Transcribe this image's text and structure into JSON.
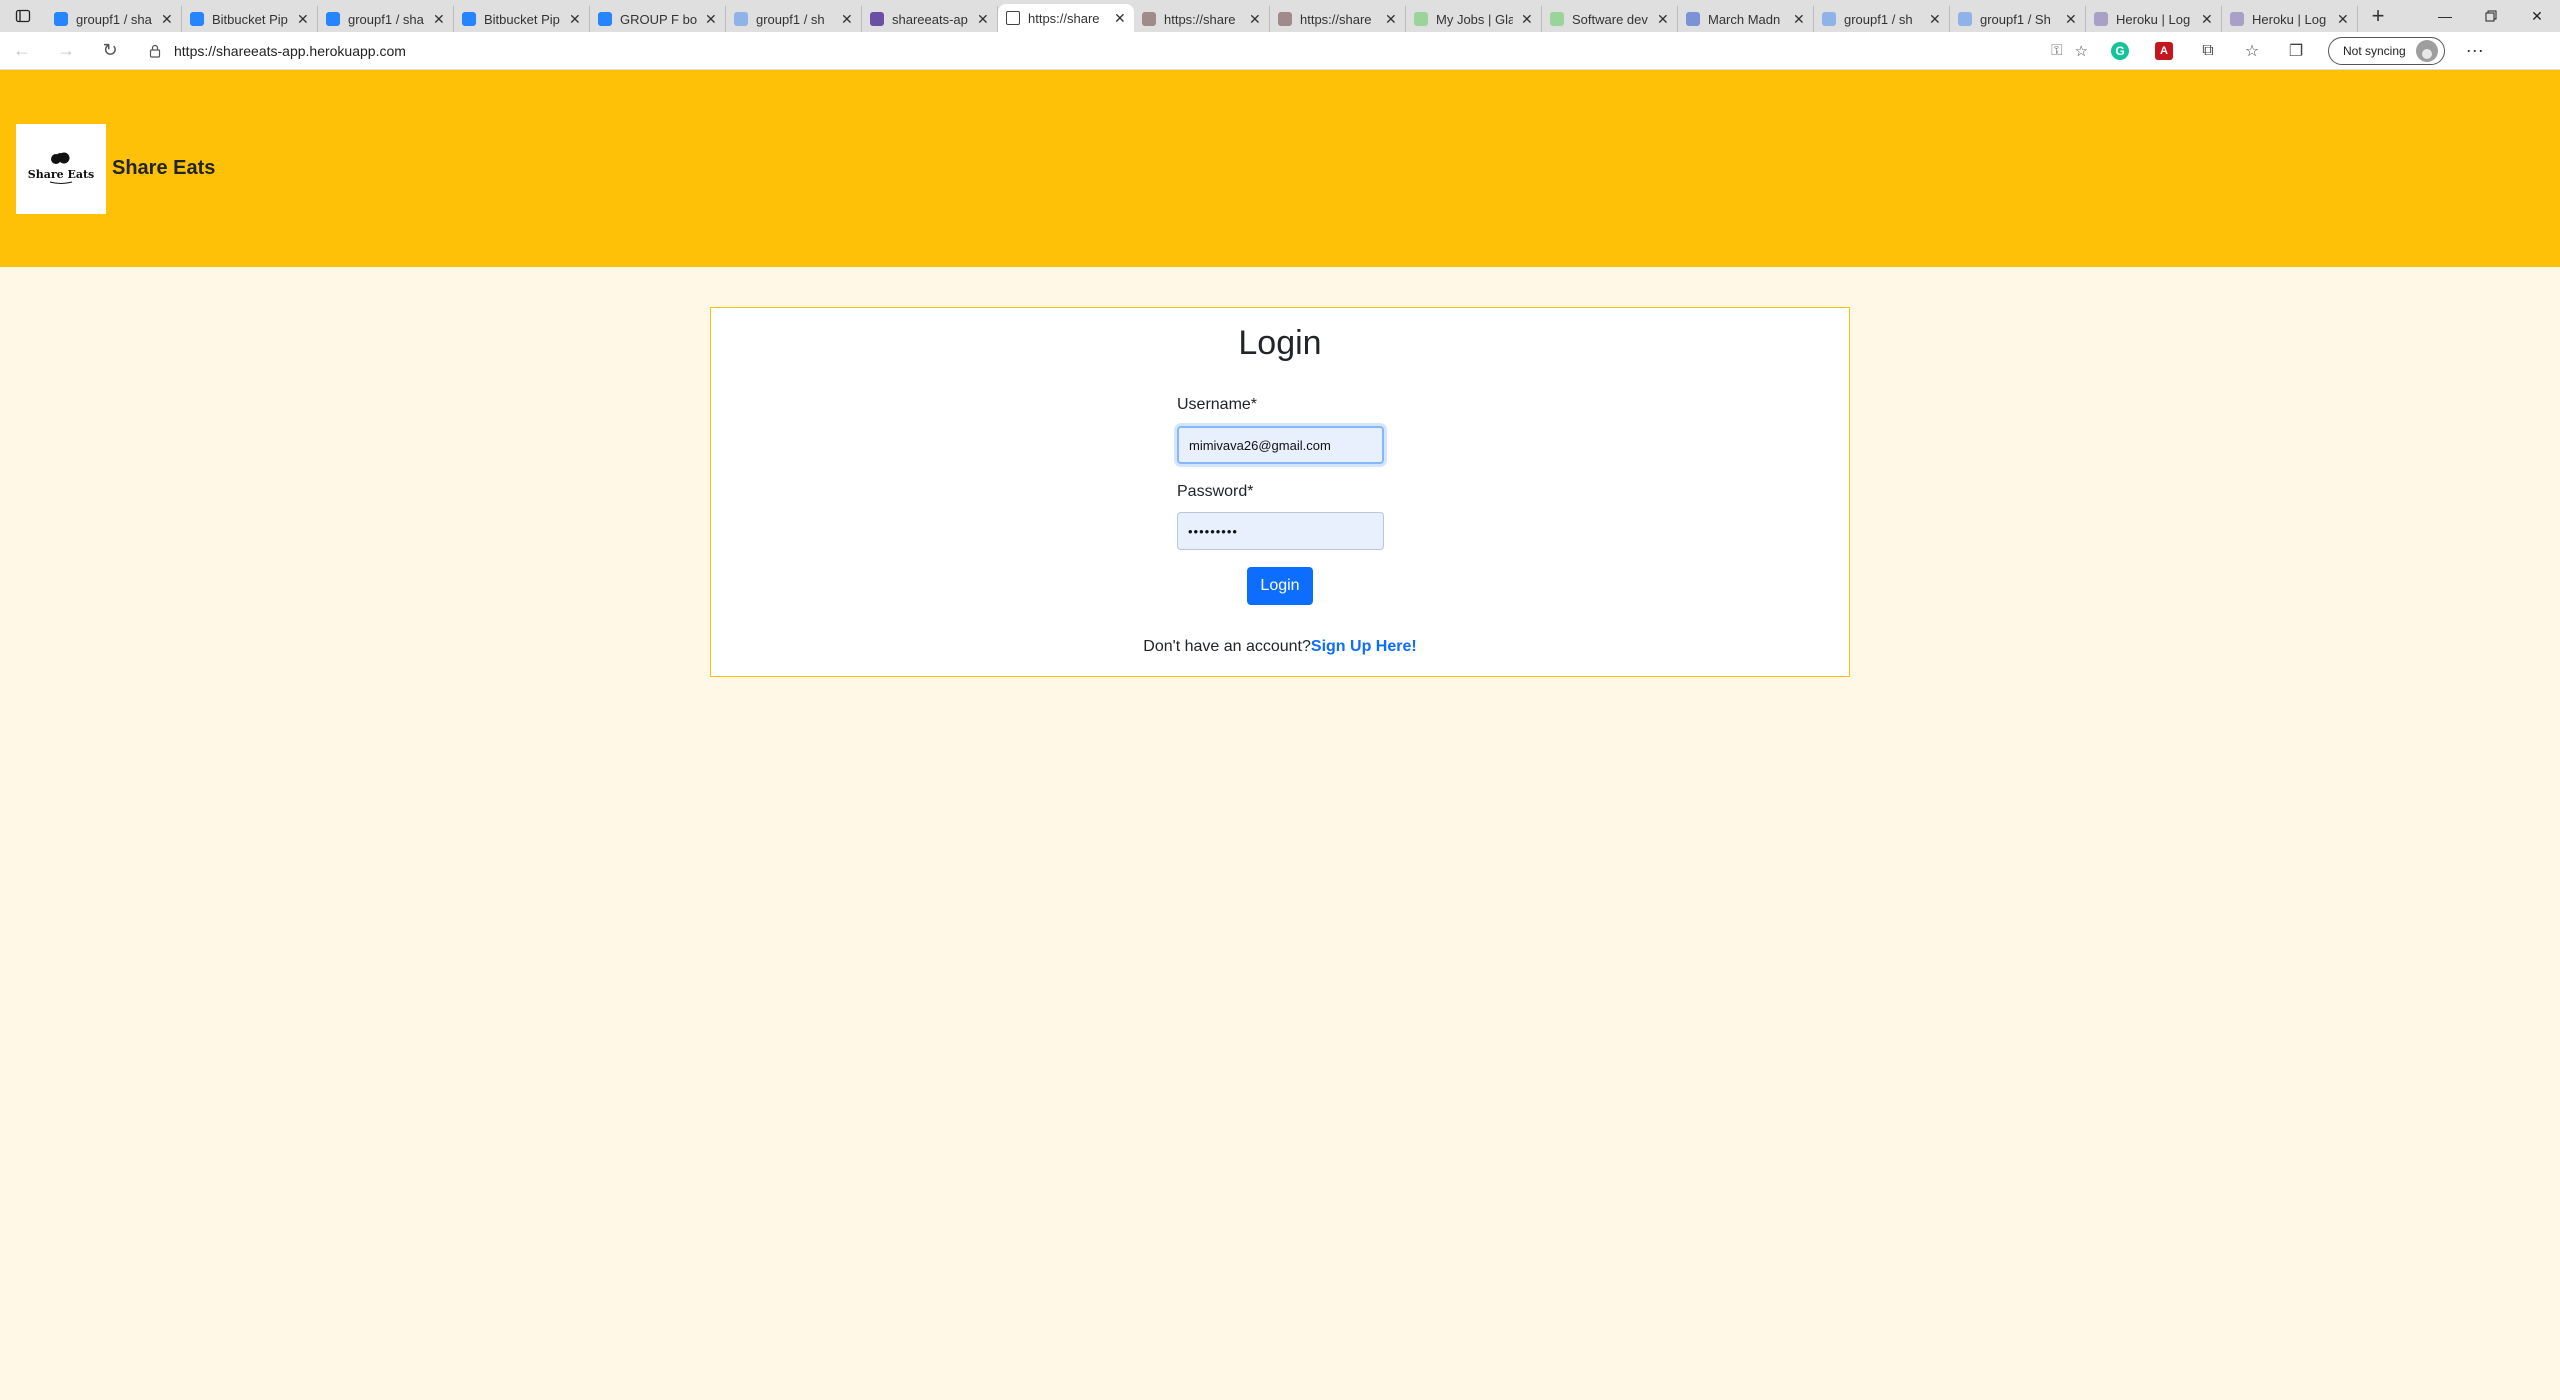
{
  "browser": {
    "tabs": [
      {
        "title": "groupf1 / sha",
        "favicon_color": "#2684ff",
        "favicon": "bitbucket-icon",
        "active": false
      },
      {
        "title": "Bitbucket Pip",
        "favicon_color": "#2684ff",
        "favicon": "bitbucket-icon",
        "active": false
      },
      {
        "title": "groupf1 / sha",
        "favicon_color": "#2684ff",
        "favicon": "bitbucket-icon",
        "active": false
      },
      {
        "title": "Bitbucket Pip",
        "favicon_color": "#2684ff",
        "favicon": "bitbucket-icon",
        "active": false
      },
      {
        "title": "GROUP F boa",
        "favicon_color": "#2684ff",
        "favicon": "jira-icon",
        "active": false
      },
      {
        "title": "groupf1 / sh",
        "favicon_color": "#8fb3e8",
        "favicon": "bitbucket-icon",
        "active": false
      },
      {
        "title": "shareeats-ap",
        "favicon_color": "#6b4fa5",
        "favicon": "heroku-icon",
        "active": false
      },
      {
        "title": "https://share",
        "favicon_color": "#ffffff",
        "favicon": "page-icon",
        "active": true
      },
      {
        "title": "https://share",
        "favicon_color": "#a08a8a",
        "favicon": "page-icon",
        "active": false
      },
      {
        "title": "https://share",
        "favicon_color": "#a08a8a",
        "favicon": "page-icon",
        "active": false
      },
      {
        "title": "My Jobs | Gla",
        "favicon_color": "#9ad49a",
        "favicon": "glassdoor-icon",
        "active": false
      },
      {
        "title": "Software dev",
        "favicon_color": "#9ad49a",
        "favicon": "glassdoor-icon",
        "active": false
      },
      {
        "title": "March Madn",
        "favicon_color": "#7b93d6",
        "favicon": "docs-icon",
        "active": false
      },
      {
        "title": "groupf1 / sh",
        "favicon_color": "#8fb3e8",
        "favicon": "bitbucket-icon",
        "active": false
      },
      {
        "title": "groupf1 / Sh",
        "favicon_color": "#8fb3e8",
        "favicon": "bitbucket-icon",
        "active": false
      },
      {
        "title": "Heroku | Log",
        "favicon_color": "#a9a0c8",
        "favicon": "heroku-icon",
        "active": false
      },
      {
        "title": "Heroku | Log",
        "favicon_color": "#a9a0c8",
        "favicon": "heroku-icon",
        "active": false
      }
    ],
    "url": "https://shareeats-app.herokuapp.com",
    "sync_label": "Not syncing"
  },
  "header": {
    "logo_text": "Share Eats",
    "brand": "Share Eats",
    "bg_color": "#ffc107"
  },
  "login": {
    "title": "Login",
    "username_label": "Username*",
    "username_value": "mimivava26@gmail.com",
    "password_label": "Password*",
    "password_value": "•••••••••",
    "submit_label": "Login",
    "signup_prompt": "Don't have an account?",
    "signup_link": "Sign Up Here!"
  },
  "colors": {
    "page_bg": "#fff8e6",
    "accent": "#0d6efd",
    "card_border": "#ffc107"
  }
}
